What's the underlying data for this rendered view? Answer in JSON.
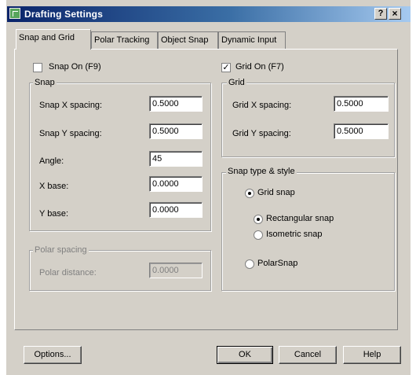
{
  "window": {
    "title": "Drafting Settings",
    "help_glyph": "?",
    "close_glyph": "×"
  },
  "tabs": [
    {
      "label": "Snap and Grid",
      "active": true
    },
    {
      "label": "Polar Tracking",
      "active": false
    },
    {
      "label": "Object Snap",
      "active": false
    },
    {
      "label": "Dynamic Input",
      "active": false
    }
  ],
  "snap_on": {
    "label": "Snap On (F9)",
    "checked": false,
    "mark": ""
  },
  "grid_on": {
    "label": "Grid On (F7)",
    "checked": true,
    "mark": "✓"
  },
  "snap": {
    "title": "Snap",
    "x_spacing": {
      "label": "Snap X spacing:",
      "value": "0.5000"
    },
    "y_spacing": {
      "label": "Snap Y spacing:",
      "value": "0.5000"
    },
    "angle": {
      "label": "Angle:",
      "value": "45"
    },
    "x_base": {
      "label": "X base:",
      "value": "0.0000"
    },
    "y_base": {
      "label": "Y base:",
      "value": "0.0000"
    }
  },
  "grid": {
    "title": "Grid",
    "x_spacing": {
      "label": "Grid X spacing:",
      "value": "0.5000"
    },
    "y_spacing": {
      "label": "Grid Y spacing:",
      "value": "0.5000"
    }
  },
  "polar_spacing": {
    "title": "Polar spacing",
    "distance_label": "Polar distance:",
    "distance_value": "0.0000",
    "enabled": false
  },
  "snap_type": {
    "title": "Snap type & style",
    "grid_snap": {
      "label": "Grid snap",
      "selected": true
    },
    "rectangular": {
      "label": "Rectangular snap",
      "selected": true
    },
    "isometric": {
      "label": "Isometric snap",
      "selected": false
    },
    "polar_snap": {
      "label": "PolarSnap",
      "selected": false
    }
  },
  "buttons": {
    "options": "Options...",
    "ok": "OK",
    "cancel": "Cancel",
    "help": "Help"
  },
  "colors": {
    "dialog_bg": "#d4d0c8",
    "title_start": "#0a246a",
    "title_end": "#a6caf0"
  }
}
